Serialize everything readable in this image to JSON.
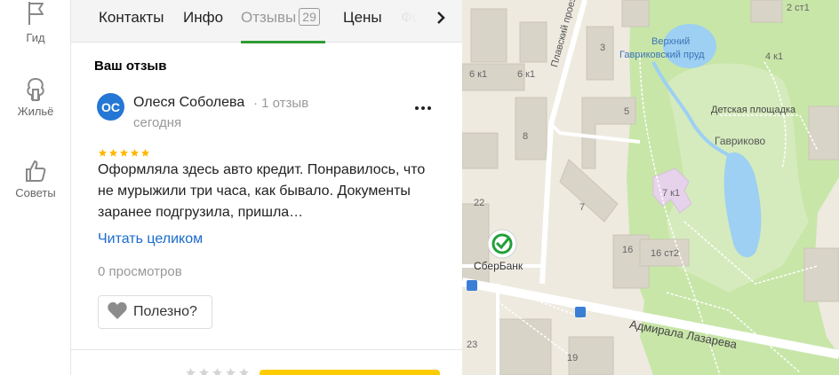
{
  "sidebar": {
    "items": [
      {
        "label": "Гид",
        "icon": "flag-icon"
      },
      {
        "label": "Жильё",
        "icon": "tree-house-icon"
      },
      {
        "label": "Советы",
        "icon": "thumbs-up-icon"
      }
    ]
  },
  "tabs": {
    "items": [
      {
        "label": "Контакты"
      },
      {
        "label": "Инфо"
      },
      {
        "label": "Отзывы",
        "count": "29",
        "active": true
      },
      {
        "label": "Цены"
      },
      {
        "label": "Фо"
      }
    ]
  },
  "review_section": {
    "title": "Ваш отзыв"
  },
  "review": {
    "avatar_initials": "ОС",
    "avatar_color": "#2477d5",
    "author": "Олеся Соболева",
    "author_meta": "· 1 отзыв",
    "date": "сегодня",
    "rating": 5,
    "text": "Оформляла здесь авто кредит. Понравилось, что не мурыжили три часа, как бывало. Документы заранее подгрузила, пришла…",
    "read_more": "Читать целиком",
    "views": "0 просмотров",
    "useful_label": "Полезно?"
  },
  "rate_prompt": {
    "rating": 0
  },
  "map": {
    "labels": {
      "pond": "Верхний Гавриковский пруд",
      "pond_line1": "Верхний",
      "pond_line2": "Гавриковский пруд",
      "playground": "Детская площадка",
      "gavrikovo": "Гаврико",
      "gavrikovo_tail": "во",
      "proezd": "Плавский проезд",
      "street": "Адмирала Лазарева",
      "sber": "СберБанк",
      "bld_6k1_a": "6 к1",
      "bld_6k1_b": "6 к1",
      "bld_4k1": "4 к1",
      "bld_2st1": "2 ст1",
      "bld_5": "5",
      "bld_8": "8",
      "bld_7k1": "7 к1",
      "bld_7": "7",
      "bld_16": "16",
      "bld_16st2": "16 ст2",
      "bld_22": "22",
      "bld_23": "23",
      "bld_19": "19",
      "bld_3": "3"
    },
    "colors": {
      "background": "#eeeae0",
      "park": "#c8e6a8",
      "water": "#9dd0f2",
      "building": "#d9d4c8",
      "road": "#ffffff",
      "sber_green": "#21a038"
    }
  }
}
